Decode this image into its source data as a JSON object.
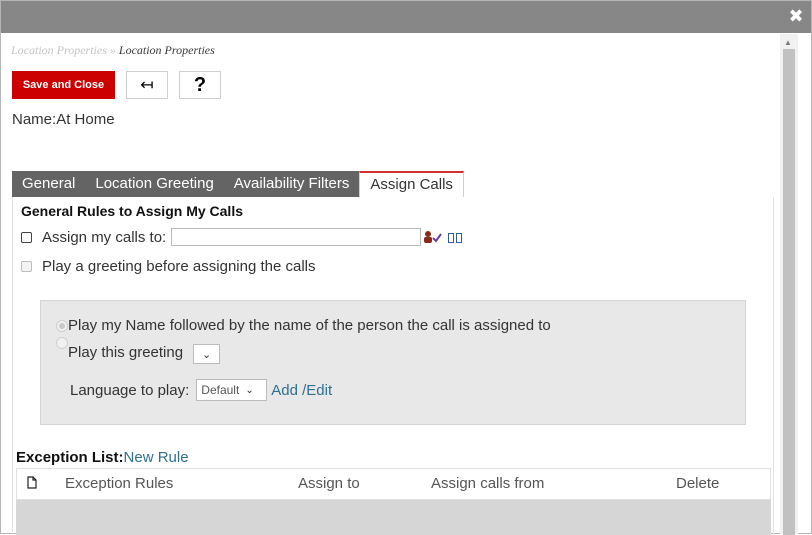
{
  "window": {
    "close_icon": "close-icon",
    "breadcrumb": {
      "parent": "Location Properties",
      "separator": " » ",
      "current": "Location Properties"
    }
  },
  "toolbar": {
    "save_label": "Save and Close",
    "back_icon": "back-arrow-icon",
    "back_glyph": "↤",
    "help_label": "?"
  },
  "name": {
    "label": "Name:",
    "value": "At Home"
  },
  "tabs": [
    {
      "label": "General"
    },
    {
      "label": "Location Greeting"
    },
    {
      "label": "Availability Filters"
    },
    {
      "label": "Assign Calls",
      "active": true
    }
  ],
  "assign": {
    "section_title": "General Rules to Assign My Calls",
    "assign_calls_label": "Assign my calls to:",
    "assign_calls_value": "",
    "play_greeting_label": "Play a greeting before assigning the calls",
    "options": {
      "play_name_label": "Play my Name followed by the name of the person the call is assigned to",
      "play_greeting_label": "Play this greeting"
    },
    "language_label": "Language to play:",
    "language_value": "Default",
    "add_edit_label": "Add /Edit"
  },
  "exceptions": {
    "label": "Exception List:",
    "new_rule_label": "New Rule",
    "columns": [
      "Exception Rules",
      "Assign to",
      "Assign calls from",
      "Delete"
    ]
  },
  "colors": {
    "accent_red": "#cc0000",
    "tab_dark": "#646464",
    "link": "#2f6f8f",
    "titlebar": "#878787"
  }
}
